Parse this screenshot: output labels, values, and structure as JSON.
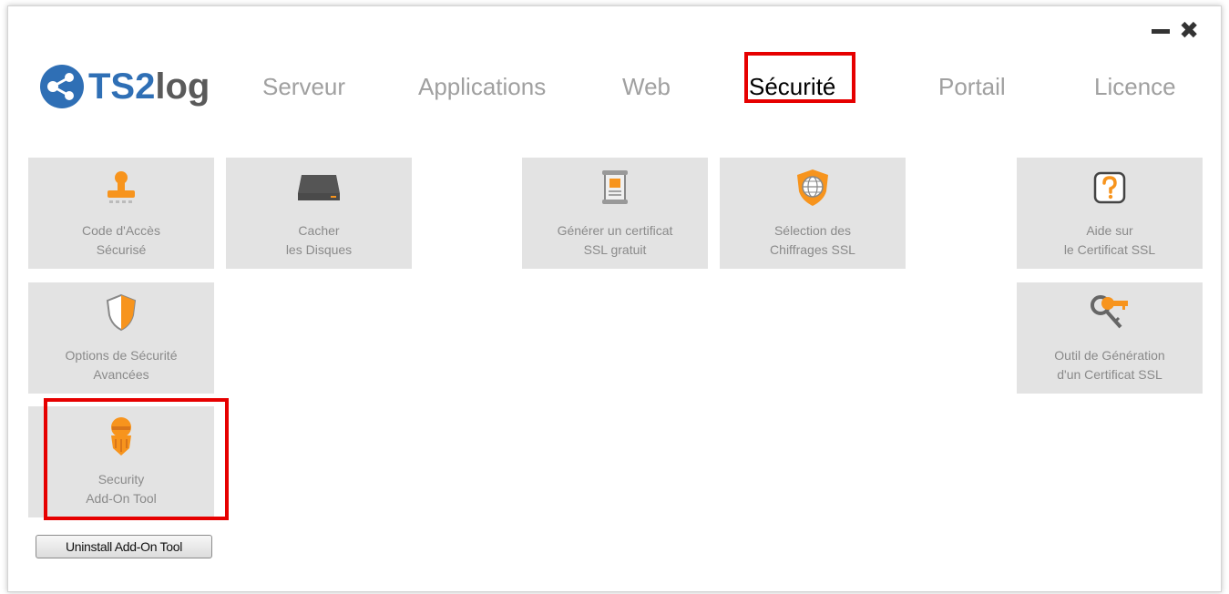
{
  "brand": {
    "name_part1": "TS2",
    "name_part2": "log",
    "icon": "share-network-icon",
    "color_primary": "#2f6fb5",
    "color_secondary": "#5a5a5a"
  },
  "window_controls": {
    "minimize_icon": "minimize-icon",
    "close_icon": "close-icon",
    "close_glyph": "✖"
  },
  "tabs": [
    {
      "label": "Serveur",
      "active": false
    },
    {
      "label": "Applications",
      "active": false
    },
    {
      "label": "Web",
      "active": false
    },
    {
      "label": "Sécurité",
      "active": true
    },
    {
      "label": "Portail",
      "active": false
    },
    {
      "label": "Licence",
      "active": false
    }
  ],
  "tiles": [
    {
      "icon": "stamp-icon",
      "line1": "Code d'Accès",
      "line2": "Sécurisé"
    },
    {
      "icon": "hard-drive-icon",
      "line1": "Cacher",
      "line2": "les Disques"
    },
    {
      "icon": "certificate-icon",
      "line1": "Générer un certificat",
      "line2": "SSL gratuit"
    },
    {
      "icon": "shield-globe-icon",
      "line1": "Sélection des",
      "line2": "Chiffrages SSL"
    },
    {
      "icon": "help-question-icon",
      "line1": "Aide sur",
      "line2": "le Certificat SSL"
    },
    {
      "icon": "shield-icon",
      "line1": "Options de Sécurité",
      "line2": "Avancées"
    },
    {
      "icon": "keys-icon",
      "line1": "Outil de Génération",
      "line2": "d'un Certificat SSL"
    },
    {
      "icon": "security-robot-icon",
      "line1": "Security",
      "line2": "Add-On Tool"
    }
  ],
  "uninstall_button": {
    "label": "Uninstall Add-On Tool"
  },
  "colors": {
    "accent_orange": "#f7941d",
    "highlight_red": "#e60000",
    "tile_bg": "#e3e3e3",
    "tab_inactive": "#a0a0a0"
  }
}
